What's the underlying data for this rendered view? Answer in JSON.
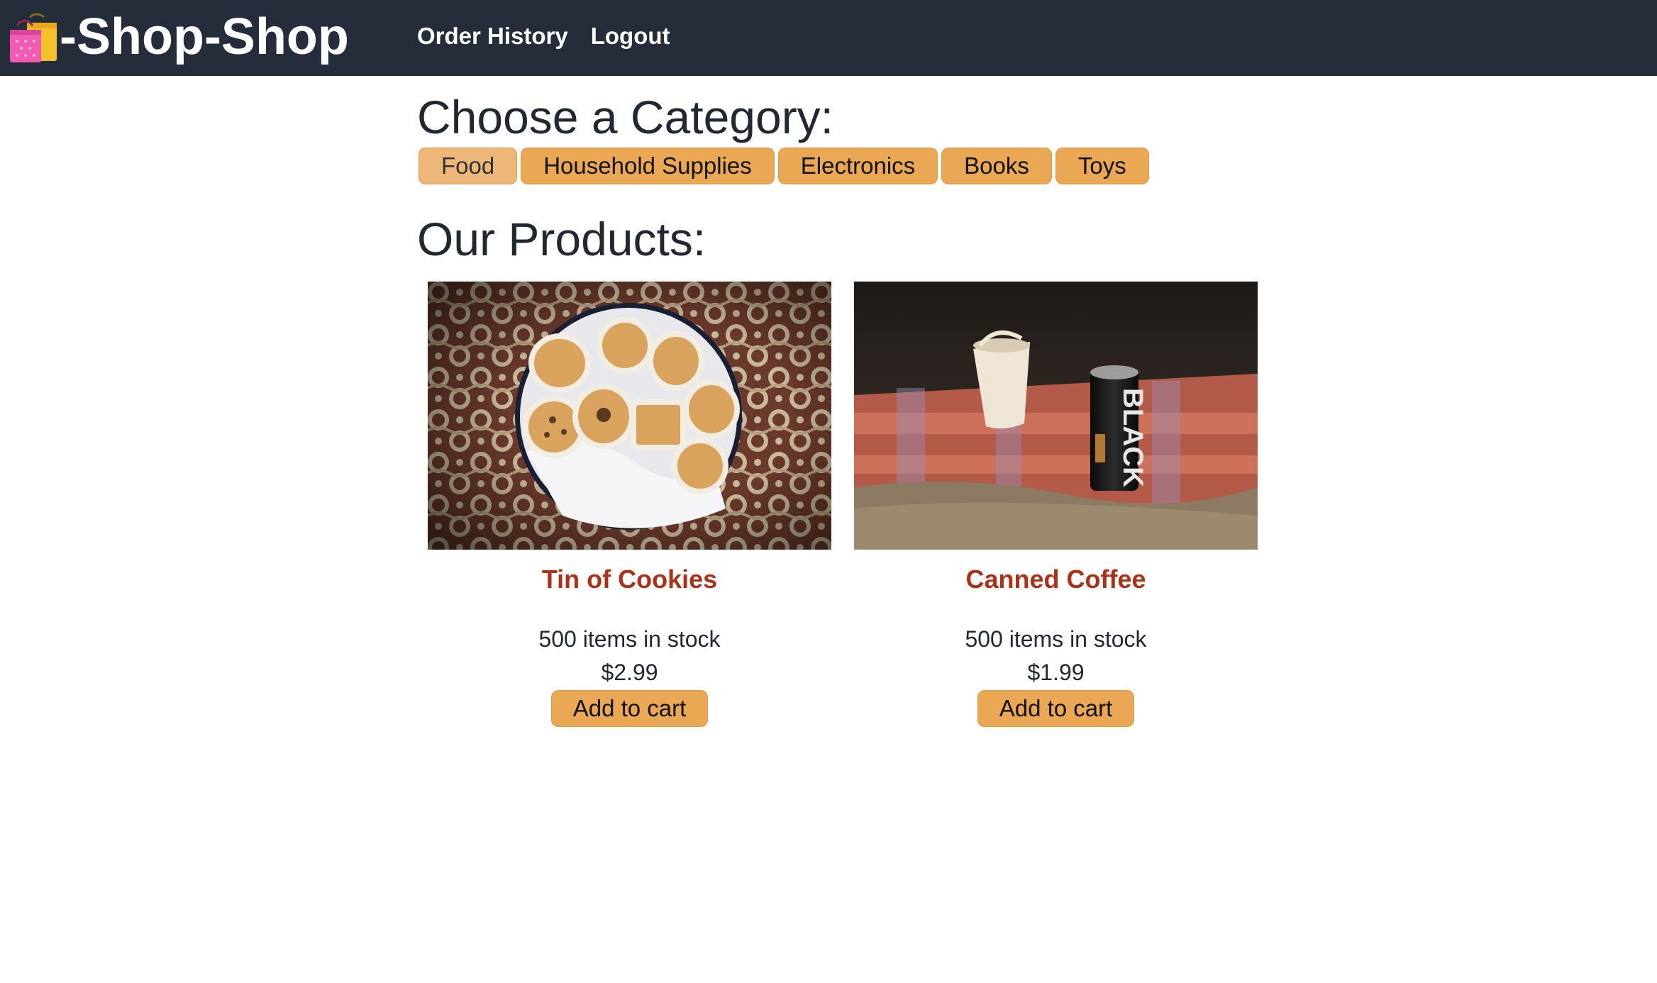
{
  "header": {
    "brand_title": "-Shop-Shop",
    "brand_icon": "shopping-bags-icon",
    "nav": {
      "order_history": "Order History",
      "logout": "Logout"
    },
    "colors": {
      "background": "#252d3b",
      "text": "#ffffff"
    }
  },
  "categories": {
    "heading": "Choose a Category:",
    "items": [
      {
        "label": "Food",
        "selected": true
      },
      {
        "label": "Household Supplies",
        "selected": false
      },
      {
        "label": "Electronics",
        "selected": false
      },
      {
        "label": "Books",
        "selected": false
      },
      {
        "label": "Toys",
        "selected": false
      }
    ],
    "button_color": "#eaa754"
  },
  "products": {
    "heading": "Our Products:",
    "items": [
      {
        "name": "Tin of Cookies",
        "image": "cookie-tin-image",
        "stock": "500 items in stock",
        "price": "$2.99",
        "add_label": "Add to cart"
      },
      {
        "name": "Canned Coffee",
        "image": "canned-coffee-image",
        "stock": "500 items in stock",
        "price": "$1.99",
        "add_label": "Add to cart"
      }
    ],
    "name_color": "#a8321a"
  }
}
